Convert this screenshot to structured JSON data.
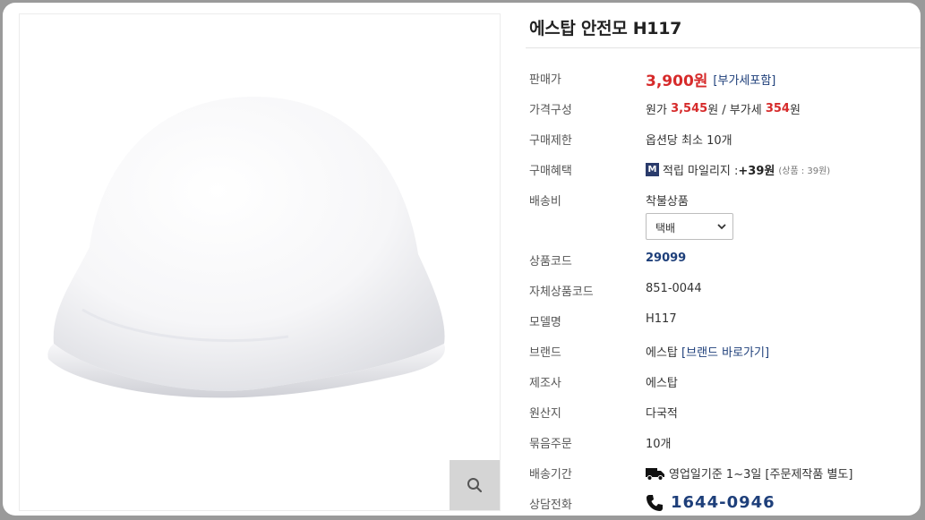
{
  "product": {
    "title": "에스탑 안전모 H117",
    "image_alt": "white safety helmet"
  },
  "colors": {
    "price_red": "#d62a2a",
    "navy": "#1e3f7a"
  },
  "rows": {
    "price": {
      "label": "판매가",
      "value": "3,900원",
      "tag": "[부가세포함]"
    },
    "price_breakdown": {
      "label": "가격구성",
      "prefix": "원가 ",
      "cost": "3,545",
      "mid": "원 / 부가세 ",
      "vat": "354",
      "suffix": "원"
    },
    "purchase_limit": {
      "label": "구매제한",
      "value": "옵션당 최소 10개"
    },
    "benefit": {
      "label": "구매혜택",
      "icon_letter": "M",
      "text": "적립 마일리지 : ",
      "amount": "+39원",
      "note": "(상품 : 39원)"
    },
    "shipping_fee": {
      "label": "배송비",
      "value": "착불상품",
      "select_value": "택배"
    },
    "product_code": {
      "label": "상품코드",
      "value": "29099"
    },
    "own_code": {
      "label": "자체상품코드",
      "value": "851-0044"
    },
    "model": {
      "label": "모델명",
      "value": "H117"
    },
    "brand": {
      "label": "브랜드",
      "value": "에스탑",
      "link": "[브랜드 바로가기]"
    },
    "maker": {
      "label": "제조사",
      "value": "에스탑"
    },
    "origin": {
      "label": "원산지",
      "value": "다국적"
    },
    "bundle": {
      "label": "묶음주문",
      "value": "10개"
    },
    "delivery": {
      "label": "배송기간",
      "value": "영업일기준 1~3일",
      "note": "[주문제작품 별도]"
    },
    "contact": {
      "label": "상담전화",
      "phone": "1644-0946"
    }
  },
  "icons": {
    "zoom": "search-icon",
    "truck": "truck-icon",
    "phone": "phone-icon",
    "select": "chevron-down-icon"
  }
}
